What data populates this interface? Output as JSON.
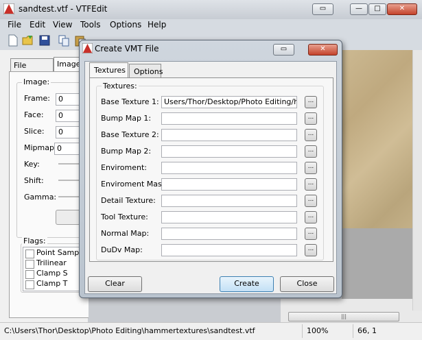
{
  "main": {
    "title": "sandtest.vtf - VTFEdit",
    "menu": [
      "File",
      "Edit",
      "View",
      "Tools",
      "Options",
      "Help"
    ],
    "tabs": [
      "File System",
      "Image"
    ],
    "image_group": {
      "label": "Image:",
      "fields": [
        {
          "label": "Frame:",
          "value": "0"
        },
        {
          "label": "Face:",
          "value": "0"
        },
        {
          "label": "Slice:",
          "value": "0"
        },
        {
          "label": "Mipmap:",
          "value": "0"
        }
      ],
      "sliders": [
        "Key:",
        "Shift:",
        "Gamma:"
      ]
    },
    "flags_group": {
      "label": "Flags:",
      "items": [
        "Point Sample",
        "Trilinear",
        "Clamp S",
        "Clamp T"
      ]
    },
    "status": {
      "path": "C:\\Users\\Thor\\Desktop\\Photo Editing\\hammertextures\\sandtest.vtf",
      "zoom": "100%",
      "coords": "66, 1"
    }
  },
  "dialog": {
    "title": "Create VMT File",
    "tabs": [
      "Textures",
      "Options"
    ],
    "group_label": "Textures:",
    "rows": [
      {
        "label": "Base Texture 1:",
        "value": "Users/Thor/Desktop/Photo Editing/hamm"
      },
      {
        "label": "Bump Map 1:",
        "value": ""
      },
      {
        "label": "Base Texture 2:",
        "value": ""
      },
      {
        "label": "Bump Map 2:",
        "value": ""
      },
      {
        "label": "Enviroment:",
        "value": ""
      },
      {
        "label": "Enviroment Mask:",
        "value": ""
      },
      {
        "label": "Detail Texture:",
        "value": ""
      },
      {
        "label": "Tool Texture:",
        "value": ""
      },
      {
        "label": "Normal Map:",
        "value": ""
      },
      {
        "label": "DuDv Map:",
        "value": ""
      }
    ],
    "browse_label": "...",
    "buttons": {
      "clear": "Clear",
      "create": "Create",
      "close": "Close"
    }
  }
}
